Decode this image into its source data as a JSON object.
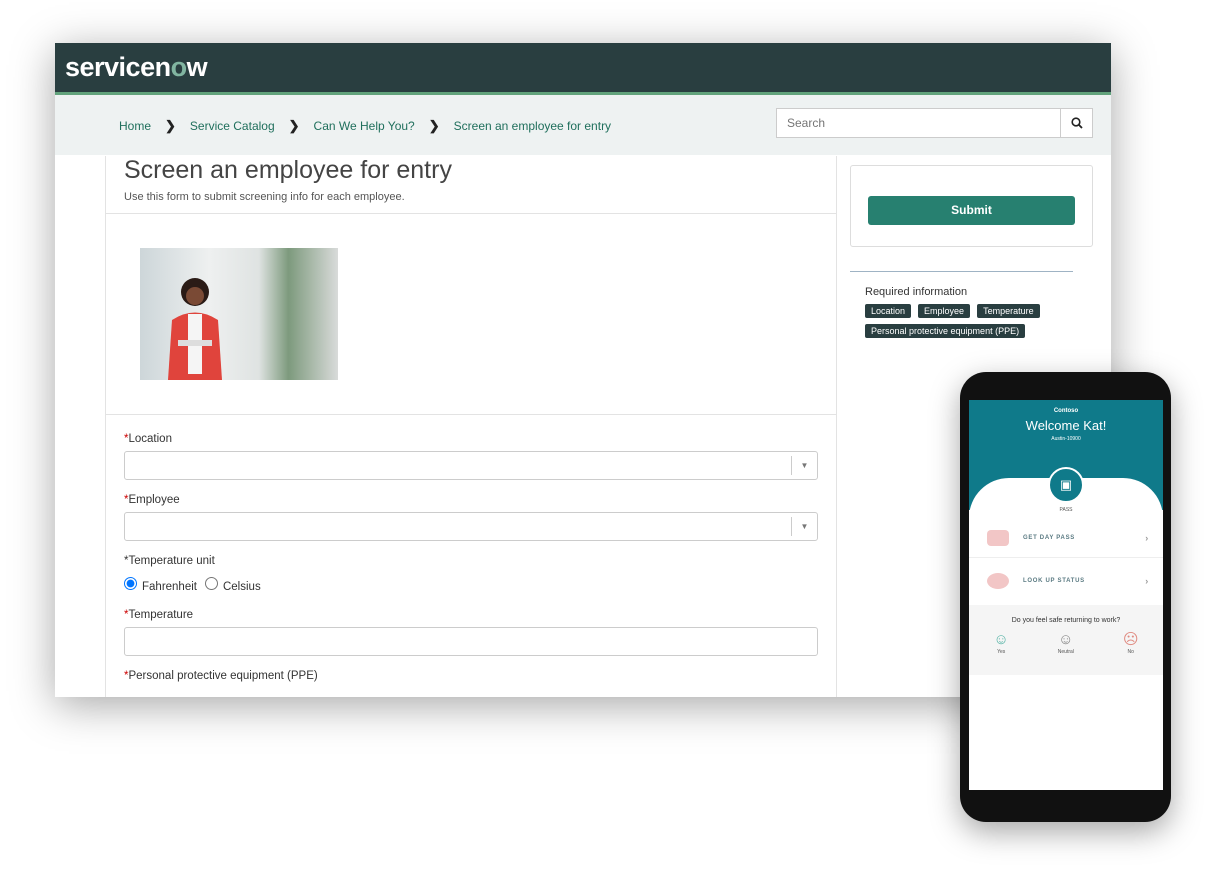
{
  "header": {
    "logo": "servicenow"
  },
  "breadcrumb": [
    "Home",
    "Service Catalog",
    "Can We Help You?",
    "Screen an employee for entry"
  ],
  "search": {
    "placeholder": "Search"
  },
  "form": {
    "title": "Screen an employee for entry",
    "subtitle": "Use this form to submit screening info for each employee.",
    "fields": {
      "location": "Location",
      "employee": "Employee",
      "temp_unit": "Temperature unit",
      "temperature": "Temperature",
      "ppe": "Personal protective equipment (PPE)"
    },
    "radios": {
      "fahrenheit": "Fahrenheit",
      "celsius": "Celsius",
      "selected": "Fahrenheit"
    },
    "required_mark": "*"
  },
  "sidebar": {
    "submit": "Submit",
    "required_label": "Required information",
    "tags": [
      "Location",
      "Employee",
      "Temperature",
      "Personal protective equipment (PPE)"
    ]
  },
  "phone": {
    "org": "Contoso",
    "welcome": "Welcome Kat!",
    "location": "Austin-10900",
    "pass": "PASS",
    "get_day_pass": "GET DAY PASS",
    "look_up_status": "LOOK UP STATUS",
    "question": "Do you feel safe returning to work?",
    "answers": [
      "Yes",
      "Neutral",
      "No"
    ]
  },
  "colors": {
    "header": "#293e40",
    "accent": "#278070",
    "phone_teal": "#0f7a8a"
  }
}
